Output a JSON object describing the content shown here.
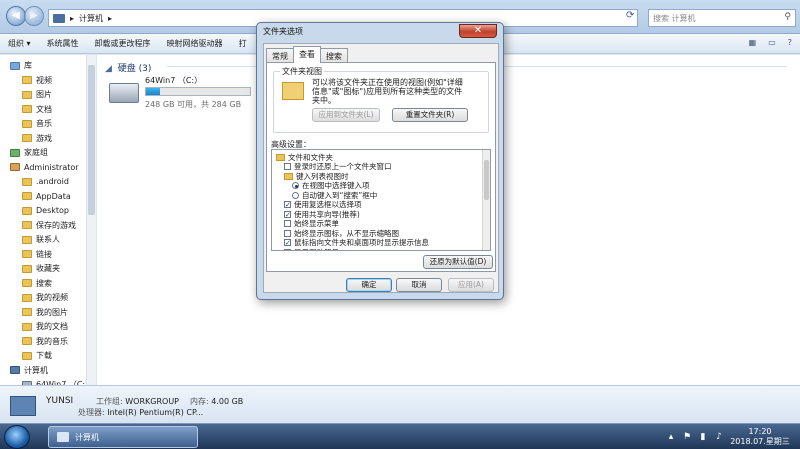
{
  "address": {
    "path": "计算机",
    "search_placeholder": "搜索 计算机"
  },
  "toolbar": {
    "items": [
      "组织 ▾",
      "系统属性",
      "卸载或更改程序",
      "映射网络驱动器",
      "打"
    ]
  },
  "nav": {
    "items": [
      {
        "label": "库",
        "icon": "library-icon"
      },
      {
        "label": "视频",
        "icon": "folder-icon"
      },
      {
        "label": "图片",
        "icon": "folder-icon"
      },
      {
        "label": "文档",
        "icon": "folder-icon"
      },
      {
        "label": "音乐",
        "icon": "folder-icon"
      },
      {
        "label": "游戏",
        "icon": "folder-icon"
      },
      {
        "label": "家庭组",
        "icon": "homegroup-icon"
      },
      {
        "label": "Administrator",
        "icon": "user-icon"
      },
      {
        "label": ".android",
        "icon": "folder-icon"
      },
      {
        "label": "AppData",
        "icon": "folder-icon"
      },
      {
        "label": "Desktop",
        "icon": "folder-icon"
      },
      {
        "label": "保存的游戏",
        "icon": "folder-icon"
      },
      {
        "label": "联系人",
        "icon": "folder-icon"
      },
      {
        "label": "链接",
        "icon": "folder-icon"
      },
      {
        "label": "收藏夹",
        "icon": "folder-icon"
      },
      {
        "label": "搜索",
        "icon": "folder-icon"
      },
      {
        "label": "我的视频",
        "icon": "folder-icon"
      },
      {
        "label": "我的图片",
        "icon": "folder-icon"
      },
      {
        "label": "我的文档",
        "icon": "folder-icon"
      },
      {
        "label": "我的音乐",
        "icon": "folder-icon"
      },
      {
        "label": "下载",
        "icon": "folder-icon"
      },
      {
        "label": "计算机",
        "icon": "computer-icon"
      },
      {
        "label": "64Win7 （C:）",
        "icon": "drive-icon"
      }
    ]
  },
  "main": {
    "group_title": "硬盘 (3)",
    "drive": {
      "name": "64Win7 （C:）",
      "free_text": "248 GB 可用，共 284 GB",
      "used_fraction": 0.13
    }
  },
  "details": {
    "name": "YUNSI",
    "workgroup_label": "工作组:",
    "workgroup_value": "WORKGROUP",
    "memory_label": "内存:",
    "memory_value": "4.00 GB",
    "cpu_label": "处理器:",
    "cpu_value": "Intel(R) Pentium(R) CP..."
  },
  "dialog": {
    "title": "文件夹选项",
    "close": "✕",
    "tabs": [
      "常规",
      "查看",
      "搜索"
    ],
    "folder_view": {
      "legend": "文件夹视图",
      "description": "可以将该文件夹正在使用的视图(例如\"详细信息\"或\"图标\")应用到所有这种类型的文件夹中。",
      "apply_button": "应用到文件夹(L)",
      "reset_button": "重置文件夹(R)"
    },
    "advanced_label": "高级设置：",
    "advanced_items": [
      {
        "kind": "folder",
        "label": "文件和文件夹",
        "indent": 0
      },
      {
        "kind": "check",
        "label": "登录时还原上一个文件夹窗口",
        "checked": false,
        "indent": 1
      },
      {
        "kind": "folder",
        "label": "键入列表视图时",
        "indent": 1
      },
      {
        "kind": "radio",
        "label": "在视图中选择键入项",
        "checked": true,
        "indent": 2
      },
      {
        "kind": "radio",
        "label": "自动键入到“搜索”框中",
        "checked": false,
        "indent": 2
      },
      {
        "kind": "check",
        "label": "使用复选框以选择项",
        "checked": true,
        "indent": 1
      },
      {
        "kind": "check",
        "label": "使用共享向导(推荐)",
        "checked": true,
        "indent": 1
      },
      {
        "kind": "check",
        "label": "始终显示菜单",
        "checked": false,
        "indent": 1
      },
      {
        "kind": "check",
        "label": "始终显示图标，从不显示缩略图",
        "checked": false,
        "indent": 1
      },
      {
        "kind": "check",
        "label": "鼠标指向文件夹和桌面项时显示提示信息",
        "checked": true,
        "indent": 1
      },
      {
        "kind": "check",
        "label": "显示驱动器号",
        "checked": true,
        "indent": 1
      },
      {
        "kind": "check",
        "label": "隐藏计算机文件夹中的空驱动器",
        "checked": true,
        "indent": 1
      },
      {
        "kind": "check",
        "label": "隐藏受保护的操作系统文件(推荐)",
        "checked": false,
        "indent": 1
      }
    ],
    "restore_button": "还原为默认值(D)",
    "ok_button": "确定",
    "cancel_button": "取消",
    "apply_button": "应用(A)"
  },
  "taskbar": {
    "task_label": "计算机",
    "time": "17:20",
    "date": "2018.07.星期三"
  }
}
